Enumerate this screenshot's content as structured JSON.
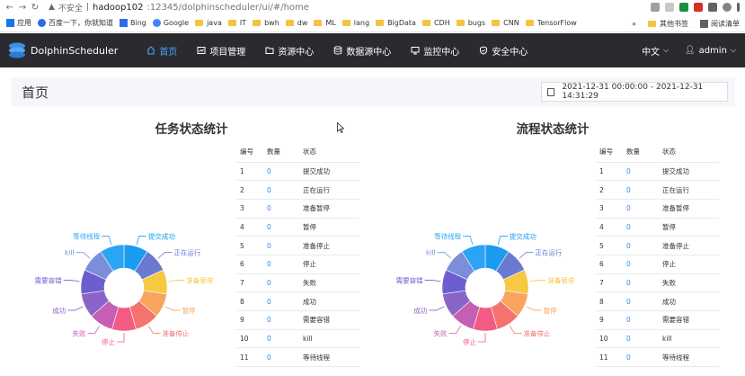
{
  "browser": {
    "insecure_label": "不安全",
    "host": "hadoop102",
    "path": ":12345/dolphinscheduler/ui/#/home",
    "bookmarks": [
      "应用",
      "百度一下，你就知道",
      "Bing",
      "Google",
      "java",
      "IT",
      "bwh",
      "dw",
      "ML",
      "lang",
      "BigData",
      "CDH",
      "bugs",
      "CNN",
      "TensorFlow"
    ],
    "other_bookmarks": "其他书签",
    "reading_list": "阅读清单",
    "overflow": "»"
  },
  "header": {
    "logo_text": "DolphinScheduler",
    "menu": [
      {
        "label": "首页",
        "icon": "home-icon",
        "active": true
      },
      {
        "label": "项目管理",
        "icon": "project-icon",
        "active": false
      },
      {
        "label": "资源中心",
        "icon": "folder-icon",
        "active": false
      },
      {
        "label": "数据源中心",
        "icon": "database-icon",
        "active": false
      },
      {
        "label": "监控中心",
        "icon": "monitor-icon",
        "active": false
      },
      {
        "label": "安全中心",
        "icon": "shield-icon",
        "active": false
      }
    ],
    "language": "中文",
    "user": "admin"
  },
  "page": {
    "title": "首页",
    "date_range": "2021-12-31 00:00:00 - 2021-12-31 14:31:29"
  },
  "colors": {
    "accent": "#4fa0ff",
    "nav_bg": "#2b2b2f",
    "link": "#2d8cf0"
  },
  "task_stats": {
    "title": "任务状态统计",
    "columns": [
      "编号",
      "数量",
      "状态"
    ],
    "rows": [
      {
        "id": "1",
        "count": "0",
        "state": "提交成功"
      },
      {
        "id": "2",
        "count": "0",
        "state": "正在运行"
      },
      {
        "id": "3",
        "count": "0",
        "state": "准备暂停"
      },
      {
        "id": "4",
        "count": "0",
        "state": "暂停"
      },
      {
        "id": "5",
        "count": "0",
        "state": "准备停止"
      },
      {
        "id": "6",
        "count": "0",
        "state": "停止"
      },
      {
        "id": "7",
        "count": "0",
        "state": "失败"
      },
      {
        "id": "8",
        "count": "0",
        "state": "成功"
      },
      {
        "id": "9",
        "count": "0",
        "state": "需要容错"
      },
      {
        "id": "10",
        "count": "0",
        "state": "kill"
      },
      {
        "id": "11",
        "count": "0",
        "state": "等待线程"
      }
    ]
  },
  "process_stats": {
    "title": "流程状态统计",
    "columns": [
      "编号",
      "数量",
      "状态"
    ],
    "rows": [
      {
        "id": "1",
        "count": "0",
        "state": "提交成功"
      },
      {
        "id": "2",
        "count": "0",
        "state": "正在运行"
      },
      {
        "id": "3",
        "count": "0",
        "state": "准备暂停"
      },
      {
        "id": "4",
        "count": "0",
        "state": "暂停"
      },
      {
        "id": "5",
        "count": "0",
        "state": "准备停止"
      },
      {
        "id": "6",
        "count": "0",
        "state": "停止"
      },
      {
        "id": "7",
        "count": "0",
        "state": "失败"
      },
      {
        "id": "8",
        "count": "0",
        "state": "成功"
      },
      {
        "id": "9",
        "count": "0",
        "state": "需要容错"
      },
      {
        "id": "10",
        "count": "0",
        "state": "kill"
      },
      {
        "id": "11",
        "count": "0",
        "state": "等待线程"
      }
    ]
  },
  "chart_data": [
    {
      "type": "pie",
      "title": "任务状态统计",
      "categories": [
        "提交成功",
        "正在运行",
        "准备暂停",
        "暂停",
        "准备停止",
        "停止",
        "失败",
        "成功",
        "需要容错",
        "kill",
        "等待线程"
      ],
      "values": [
        0,
        0,
        0,
        0,
        0,
        0,
        0,
        0,
        0,
        0,
        0
      ],
      "colors": [
        "#1a9bf0",
        "#6a7ad1",
        "#f7c842",
        "#f8a45f",
        "#f5736f",
        "#f45b84",
        "#c65fb3",
        "#8a64c8",
        "#6b5fd0",
        "#7b8ed9",
        "#2ba4f5"
      ],
      "donut": true
    },
    {
      "type": "pie",
      "title": "流程状态统计",
      "categories": [
        "提交成功",
        "正在运行",
        "准备暂停",
        "暂停",
        "准备停止",
        "停止",
        "失败",
        "成功",
        "需要容错",
        "kill",
        "等待线程"
      ],
      "values": [
        0,
        0,
        0,
        0,
        0,
        0,
        0,
        0,
        0,
        0,
        0
      ],
      "colors": [
        "#1a9bf0",
        "#6a7ad1",
        "#f7c842",
        "#f8a45f",
        "#f5736f",
        "#f45b84",
        "#c65fb3",
        "#8a64c8",
        "#6b5fd0",
        "#7b8ed9",
        "#2ba4f5"
      ],
      "donut": true
    }
  ]
}
